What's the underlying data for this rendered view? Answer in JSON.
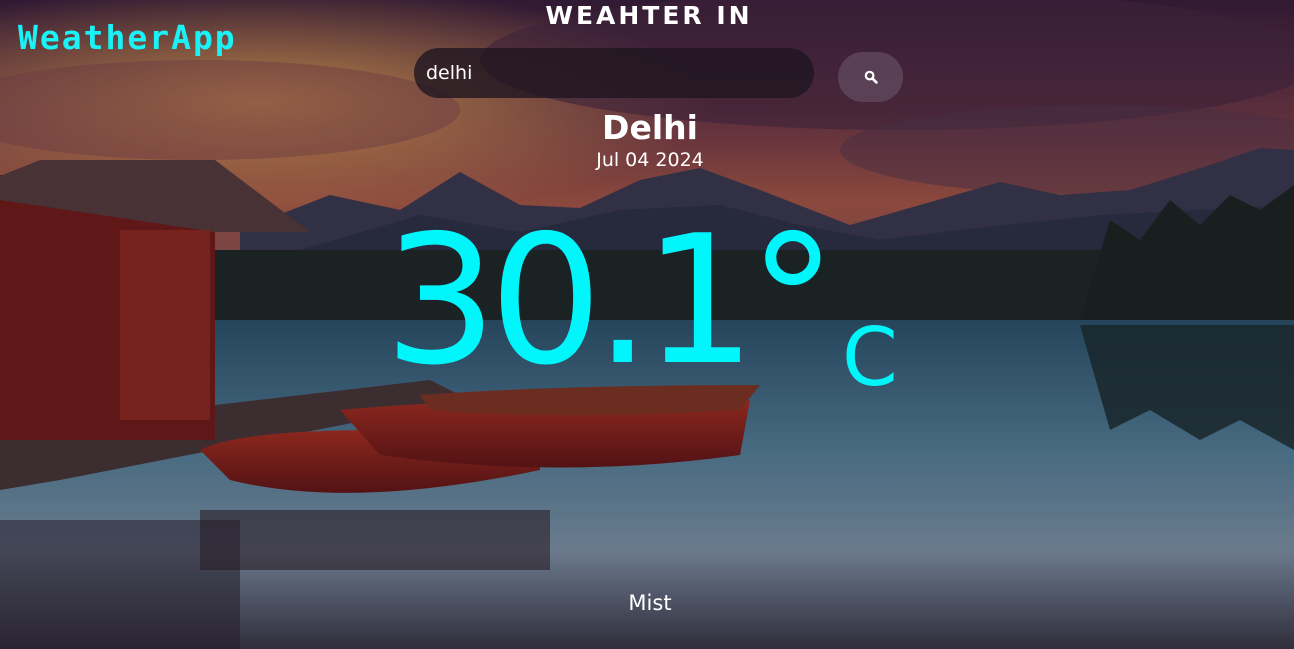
{
  "app": {
    "logo": "WeatherApp",
    "heading": "WEAHTER IN"
  },
  "search": {
    "value": "delhi",
    "button_icon": "search-icon"
  },
  "weather": {
    "city": "Delhi",
    "date": "Jul 04 2024",
    "temperature": "30.1°",
    "unit": "C",
    "condition": "Mist"
  },
  "colors": {
    "accent": "#00f6fb",
    "logo": "#19f3f7",
    "text": "#ffffff"
  }
}
